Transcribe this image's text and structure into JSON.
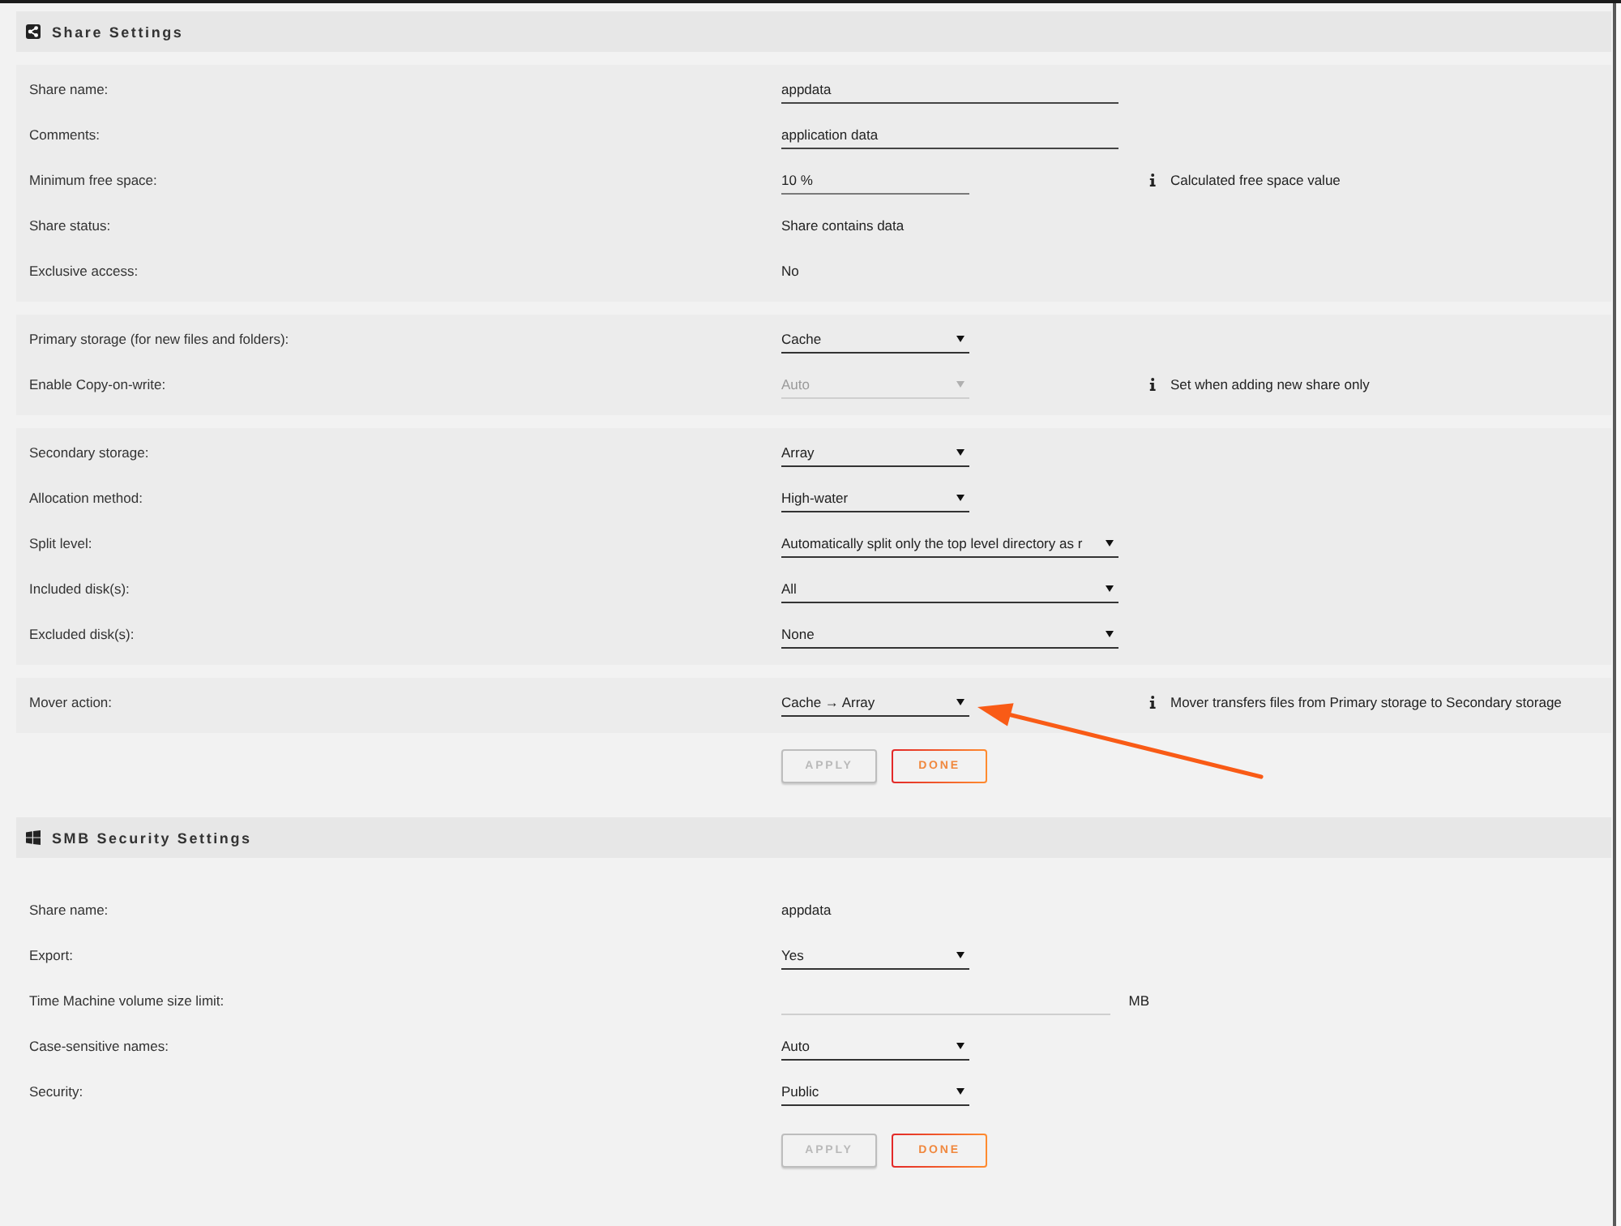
{
  "sections": [
    {
      "title": "Share Settings",
      "kind": "share",
      "groups": [
        {
          "rows": [
            {
              "label": "Share name:",
              "kind": "input",
              "value": "appdata",
              "disabled": false
            },
            {
              "label": "Comments:",
              "kind": "input",
              "value": "application data",
              "disabled": false
            },
            {
              "label": "Minimum free space:",
              "kind": "numeric",
              "value": "10 %",
              "disabled": false,
              "note": "Calculated free space value"
            },
            {
              "label": "Share status:",
              "kind": "static",
              "value": "Share contains data",
              "disabled": false
            },
            {
              "label": "Exclusive access:",
              "kind": "static",
              "value": "No",
              "disabled": false
            }
          ]
        },
        {
          "rows": [
            {
              "label": "Primary storage (for new files and folders):",
              "kind": "select",
              "value": "Cache",
              "disabled": false
            },
            {
              "label": "Enable Copy-on-write:",
              "kind": "select",
              "value": "Auto",
              "disabled": true,
              "note": "Set when adding new share only"
            }
          ]
        },
        {
          "rows": [
            {
              "label": "Secondary storage:",
              "kind": "select",
              "value": "Array",
              "disabled": false
            },
            {
              "label": "Allocation method:",
              "kind": "select",
              "value": "High-water",
              "disabled": false
            },
            {
              "label": "Split level:",
              "kind": "wideselect",
              "value": "Automatically split only the top level directory as r",
              "disabled": false
            },
            {
              "label": "Included disk(s):",
              "kind": "wideselect",
              "value": "All",
              "disabled": false
            },
            {
              "label": "Excluded disk(s):",
              "kind": "wideselect",
              "value": "None",
              "disabled": false
            }
          ]
        },
        {
          "rows": [
            {
              "label": "Mover action:",
              "kind": "select",
              "value": "Cache → Array",
              "disabled": false,
              "note": "Mover transfers files from Primary storage to Secondary storage"
            }
          ]
        }
      ],
      "buttons": [
        {
          "label": "APPLY",
          "disabled": true
        },
        {
          "label": "DONE",
          "disabled": false
        }
      ]
    },
    {
      "title": "SMB Security Settings",
      "kind": "smb",
      "groups": [
        {
          "rows": [
            {
              "label": "Share name:",
              "kind": "static",
              "value": "appdata",
              "disabled": false
            },
            {
              "label": "Export:",
              "kind": "select",
              "value": "Yes",
              "disabled": false
            },
            {
              "label": "Time Machine volume size limit:",
              "kind": "input",
              "unit": "MB",
              "disabled": false
            },
            {
              "label": "Case-sensitive names:",
              "kind": "select",
              "value": "Auto",
              "disabled": false
            },
            {
              "label": "Security:",
              "kind": "select",
              "value": "Public",
              "disabled": false
            }
          ]
        }
      ],
      "buttons": [
        {
          "label": "APPLY",
          "disabled": true
        },
        {
          "label": "DONE",
          "disabled": false
        }
      ]
    }
  ]
}
